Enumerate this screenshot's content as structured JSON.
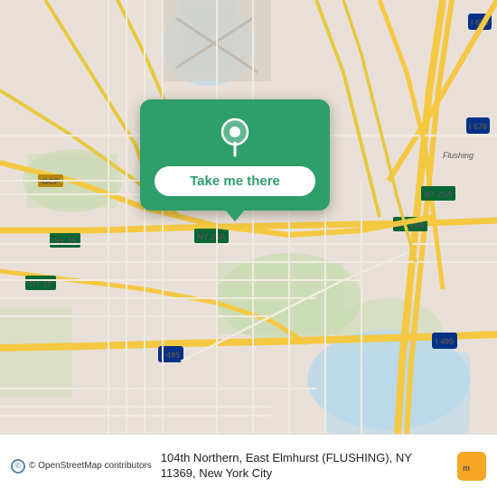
{
  "map": {
    "alt": "Map of East Elmhurst, Queens, New York City",
    "background_color": "#e8e0d8",
    "water_color": "#a8d4e8",
    "green_color": "#c8dbb0"
  },
  "popup": {
    "button_label": "Take me there",
    "pin_color": "#ffffff"
  },
  "info_bar": {
    "osm_text": "© OpenStreetMap contributors",
    "address_line1": "104th Northern, East Elmhurst (FLUSHING), NY",
    "address_line2": "11369, New York City"
  },
  "logos": {
    "moovit_text": "moovit",
    "moovit_bg": "#f5a623"
  },
  "road_labels": {
    "i678_north": "I 678",
    "i678_south": "I 678",
    "ny25a_1": "NY 25A",
    "ny25a_2": "NY 25A",
    "ny25a_3": "NY 25A",
    "ny25_1": "NY 25",
    "ny25_2": "NY 25",
    "i495_1": "I 495",
    "i495_2": "I 495",
    "gcp": "GCP"
  }
}
